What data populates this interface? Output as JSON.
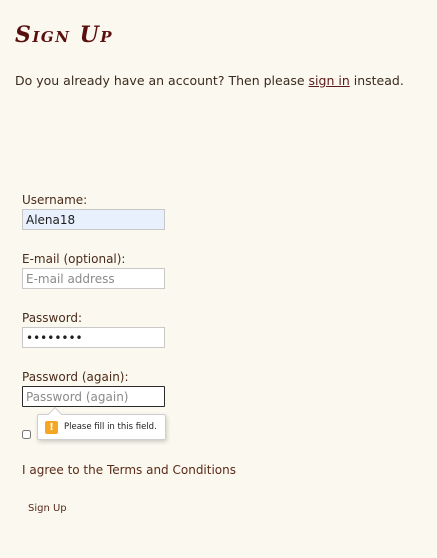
{
  "page": {
    "title": "Sign Up",
    "intro_prefix": "Do you already have an account? Then please",
    "intro_link": "sign in",
    "intro_suffix": "instead."
  },
  "form": {
    "username_label": "Username:",
    "username_value": "Alena18",
    "email_label": "E-mail (optional):",
    "email_placeholder": "E-mail address",
    "password_label": "Password:",
    "password_value": "12345678",
    "password2_label": "Password (again):",
    "password2_placeholder": "Password (again)",
    "tooltip_text": "Please fill in this field.",
    "tooltip_icon": "warning-icon",
    "agree_text": "I agree to the Terms and Conditions",
    "submit_label": "Sign Up"
  },
  "colors": {
    "background": "#fbf9ef",
    "title": "#5a0f0f",
    "autofill": "#e8f0fe",
    "warning": "#f5a623"
  }
}
